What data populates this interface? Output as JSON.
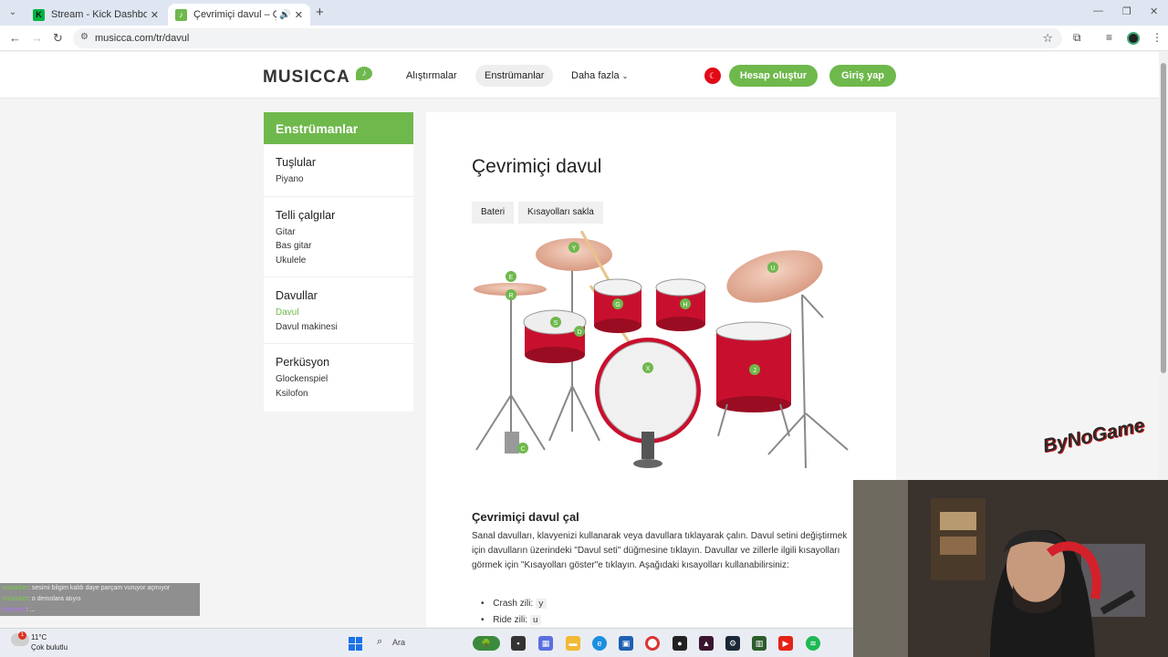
{
  "browser": {
    "tabs": [
      {
        "title": "Stream - Kick Dashboard",
        "favicon": "K"
      },
      {
        "title": "Çevrimiçi davul – Çevrimiçi",
        "favicon": "♪"
      }
    ],
    "new_tab": "+",
    "url": "musicca.com/tr/davul"
  },
  "site": {
    "logo": "MUSICCA",
    "nav": {
      "alistirmalar": "Alıştırmalar",
      "enstrumanlar": "Enstrümanlar",
      "daha_fazla": "Daha fazla"
    },
    "create_account": "Hesap oluştur",
    "login": "Giriş yap"
  },
  "sidebar": {
    "heading": "Enstrümanlar",
    "groups": [
      {
        "title": "Tuşlular",
        "items": [
          "Piyano"
        ]
      },
      {
        "title": "Telli çalgılar",
        "items": [
          "Gitar",
          "Bas gitar",
          "Ukulele"
        ]
      },
      {
        "title": "Davullar",
        "items": [
          "Davul",
          "Davul makinesi"
        ]
      },
      {
        "title": "Perküsyon",
        "items": [
          "Glockenspiel",
          "Ksilofon"
        ]
      }
    ]
  },
  "main": {
    "title": "Çevrimiçi davul",
    "btn_kit": "Bateri",
    "btn_shortcuts": "Kısayolları sakla",
    "drum_keys": [
      "E",
      "R",
      "Y",
      "U",
      "G",
      "H",
      "S",
      "D",
      "X",
      "J",
      "C"
    ],
    "subtitle": "Çevrimiçi davul çal",
    "paragraph": "Sanal davulları, klavyenizi kullanarak veya davullara tıklayarak çalın. Davul setini değiştirmek için davulların üzerindeki \"Davul seti\" düğmesine tıklayın. Davullar ve zillerle ilgili kısayolları görmek için \"Kısayolları göster\"e tıklayın. Aşağıdaki kısayolları kullanabilirsiniz:",
    "shortcuts": [
      {
        "label": "Crash zili:",
        "key": "y"
      },
      {
        "label": "Ride zili:",
        "key": "u"
      }
    ]
  },
  "overlay": {
    "watermark": "ByNoGame",
    "chat": [
      {
        "user": "musicker",
        "text": "sesimi bilgim kaldı daye parçam vuruyor açmıyor"
      },
      {
        "user": "musicker",
        "text": "o demolara atıyıs"
      },
      {
        "user": "Berkes0",
        "text": "..."
      }
    ]
  },
  "taskbar": {
    "temp": "11°C",
    "weather": "Çok bulutlu",
    "search": "Ara",
    "notification_count": "1"
  },
  "colors": {
    "accent": "#6fb84c",
    "drum_red": "#c8102e",
    "cymbal": "#e7b49c"
  }
}
